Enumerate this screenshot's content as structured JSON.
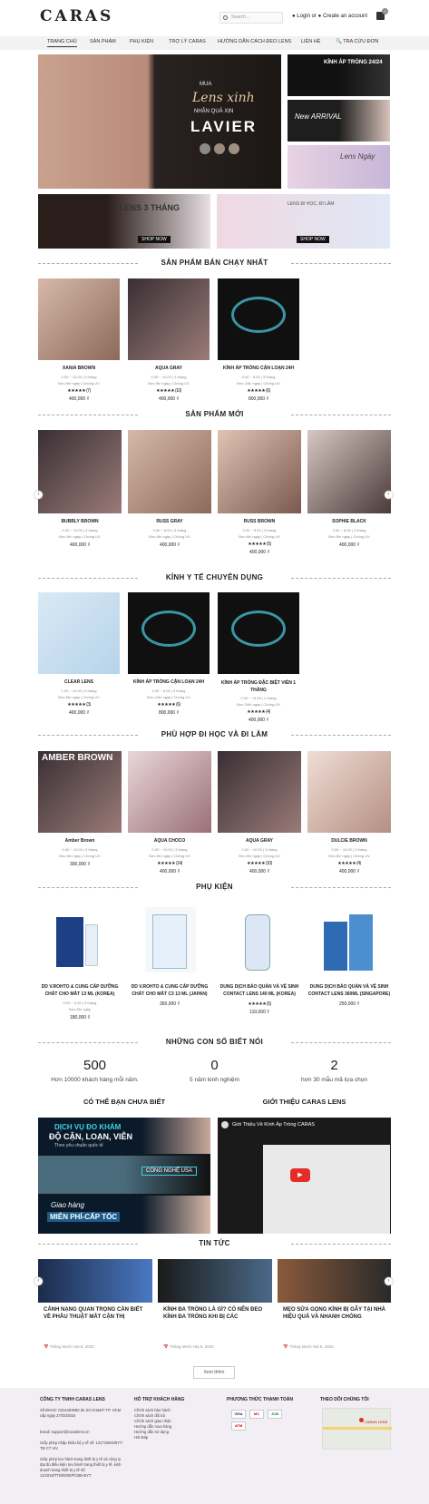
{
  "header": {
    "logo": "CARAS",
    "search_placeholder": "Search...",
    "login": "Login",
    "or": "or",
    "create": "Create an account",
    "cart_count": "0"
  },
  "nav": [
    "TRANG CHỦ",
    "SẢN PHẨM",
    "PHỤ KIỆN",
    "TRỢ LÝ CARAS",
    "HƯỚNG DẪN CÁCH ĐEO LENS",
    "LIÊN HỆ",
    "TRA CỨU ĐƠN"
  ],
  "banners": {
    "main_line1": "MUA",
    "main_line2": "Lens xinh",
    "main_line3": "NHẬN QUÀ XỊN",
    "main_brand": "LAVIER",
    "side1": "KÍNH ÁP TRÒNG 24/24",
    "side2": "New ARRIVAL",
    "side3": "Lens Ngày",
    "b2a": "LENS 3 THÁNG",
    "b2a_btn": "SHOP NOW",
    "b2b": "LENS ĐI HỌC, ĐI LÀM",
    "b2b_btn": "SHOP NOW"
  },
  "bestsellers": {
    "title": "SẢN PHẨM BÁN CHẠY NHẤT",
    "items": [
      {
        "name": "XANIA BROWN",
        "sub1": "0.00 ~ 10.00 | 3 tháng",
        "sub2": "Đeo 8h/ ngày | Chống UV",
        "stars": "★★★★★",
        "count": "(7)",
        "price": "400,000 ₫"
      },
      {
        "name": "AQUA GRAY",
        "sub1": "0.00 ~ 10.00 | 3 tháng",
        "sub2": "Đeo 8h/ ngày | Chống UV",
        "stars": "★★★★★",
        "count": "(10)",
        "price": "400,000 ₫"
      },
      {
        "name": "KÍNH ÁP TRÒNG CẬN LOẠN 24H",
        "sub1": "0.00 ~ 6.00 | 3 tháng",
        "sub2": "Đeo 24h/ ngày | Chống UV",
        "stars": "★★★★★",
        "count": "(6)",
        "price": "800,000 ₫"
      }
    ]
  },
  "newproducts": {
    "title": "SẢN PHẨM MỚI",
    "items": [
      {
        "name": "BUBBLY BROWN",
        "sub1": "0.00 ~ 10.00 | 3 tháng",
        "sub2": "Đeo 8h/ ngày | Chống UV",
        "price": "400,000 ₫"
      },
      {
        "name": "RUSS GRAY",
        "sub1": "0.00 ~ 8.00 | 3 tháng",
        "sub2": "Đeo 8h/ ngày | Chống UV",
        "price": "400,000 ₫"
      },
      {
        "name": "RUSS BROWN",
        "sub1": "0.00 ~ 8.00 | 3 tháng",
        "sub2": "Đeo 8h/ ngày | Chống UV",
        "stars": "★★★★★",
        "count": "(5)",
        "price": "400,000 ₫"
      },
      {
        "name": "SOPHIE BLACK",
        "sub1": "0.00 ~ 8.00 | 3 tháng",
        "sub2": "Đeo 8h/ ngày | Chống UV",
        "price": "400,000 ₫"
      }
    ]
  },
  "medical": {
    "title": "KÍNH Y TẾ CHUYÊN DỤNG",
    "items": [
      {
        "name": "CLEAR LENS",
        "sub1": "1.00 ~ 10.00 | 3 tháng",
        "sub2": "Đeo 8h/ ngày | Chống UV",
        "stars": "★★★★★",
        "count": "(3)",
        "price": "400,000 ₫"
      },
      {
        "name": "KÍNH ÁP TRÒNG CẬN LOẠN 24H",
        "sub1": "0.00 ~ 6.00 | 3 tháng",
        "sub2": "Đeo 24h/ ngày | Chống UV",
        "stars": "★★★★★",
        "count": "(6)",
        "price": "800,000 ₫"
      },
      {
        "name": "KÍNH ÁP TRÒNG ĐẶC BIỆT VIỄN 1 THÁNG",
        "sub1": "0.00 ~ +6.00 | 1 tháng",
        "sub2": "Đeo 24h/ ngày | Chống UV",
        "stars": "★★★★★",
        "count": "(4)",
        "price": "400,000 ₫"
      }
    ]
  },
  "school": {
    "title": "PHÙ HỢP ĐI HỌC VÀ ĐI LÀM",
    "items": [
      {
        "name": "Amber Brown",
        "sub1": "0.00 ~ 10.00 | 3 tháng",
        "sub2": "Đeo 8h/ ngày | Chống UV",
        "price": "300,000 ₫"
      },
      {
        "name": "AQUA CHOCO",
        "sub1": "0.00 ~ 10.00 | 3 tháng",
        "sub2": "Đeo 8h/ ngày | Chống UV",
        "stars": "★★★★★",
        "count": "(14)",
        "price": "400,000 ₫"
      },
      {
        "name": "AQUA GRAY",
        "sub1": "0.00 ~ 10.00 | 3 tháng",
        "sub2": "Đeo 8h/ ngày | Chống UV",
        "stars": "★★★★★",
        "count": "(10)",
        "price": "400,000 ₫"
      },
      {
        "name": "DULCIE BROWN",
        "sub1": "0.00 ~ 10.00 | 3 tháng",
        "sub2": "Đeo 8h/ ngày | Chống UV",
        "stars": "★★★★★",
        "count": "(4)",
        "price": "400,000 ₫"
      }
    ]
  },
  "accessories": {
    "title": "PHỤ KIỆN",
    "items": [
      {
        "name": "DD V.ROHTO & CUNG CẤP DƯỠNG CHẤT CHO MẮT 13 ML (KOREA)",
        "sub1": "0.00 ~ 0.00 | 3 tháng",
        "sub2": "Đeo 8h/ ngày",
        "price": "180,000 ₫"
      },
      {
        "name": "DD V.ROHTO & CUNG CẤP DƯỠNG CHẤT CHO MẮT C3 13 ML (JAPAN)",
        "price": "350,000 ₫"
      },
      {
        "name": "DUNG DỊCH BẢO QUẢN VÀ VỆ SINH CONTACT LENS 140 ML (KOREA)",
        "stars": "★★★★★",
        "count": "(5)",
        "price": "110,000 ₫"
      },
      {
        "name": "DUNG DỊCH BẢO QUẢN VÀ VỆ SINH CONTACT LENS 360ML (SINGAPORE)",
        "price": "250,000 ₫"
      }
    ]
  },
  "stats": {
    "title": "NHỮNG CON SỐ BIẾT NÓI",
    "items": [
      {
        "num": "500",
        "label": "Hơn 10000 khách hàng mỗi năm."
      },
      {
        "num": "0",
        "label": "5 năm kinh nghiệm"
      },
      {
        "num": "2",
        "label": "hơn 30 mẫu mã lựa chọn"
      }
    ]
  },
  "about": {
    "left_title": "CÓ THỂ BẠN CHƯA BIẾT",
    "right_title": "GIỚI THIỆU CARAS LENS",
    "promo1a": "DỊCH VỤ ĐO KHÁM",
    "promo1b": "ĐỘ CẬN, LOẠN, VIỄN",
    "promo1c": "Theo yêu chuẩn quốc tế",
    "promo2": "CÔNG NGHỆ USA",
    "promo3a": "Giao hàng",
    "promo3b": "MIỄN PHÍ-CẤP TỐC",
    "video_title": "Giới Thiệu Về Kính Áp Tròng CARAS"
  },
  "news": {
    "title": "TIN TỨC",
    "items": [
      {
        "title": "CẢNH NẠNG QUAN TRỌNG CẦN BIẾT VỀ PHẪU THUẬT MẮT CẬN THỊ",
        "date": "Tháng Mười Hai 8, 2020"
      },
      {
        "title": "KÍNH ĐA TRÒNG LÀ GÌ? CÓ NÊN ĐEO KÍNH ĐA TRÒNG KHI BỊ CÁC",
        "date": "Tháng Mười Hai 5, 2020"
      },
      {
        "title": "MẸO SỬA GỌNG KÍNH BỊ GÃY TẠI NHÀ HIỆU QUẢ VÀ NHANH CHÓNG",
        "date": "Tháng Mười Hai 5, 2020"
      }
    ],
    "more": "Xem thêm"
  },
  "footer": {
    "c1_title": "CÔNG TY TNHH CARAS LENS",
    "c1_lines": [
      "Số ĐKKD: 0314493690 do Sở KH&ĐT TP. HCM cấp ngày 27/03/2016",
      "Email: support@caraslens.vn",
      "Giấy phép nhập khẩu bộ y tế số: 131716NK/BYT-TB-CT ViV",
      "Giấy phép lưu hành trang thiết bị y tế và công ty đạt đủ điều kiện lưu hành trang thiết bị y tế, kinh doanh trang thiết bị y tế số: 11/2018/TTB/0000/PCBB-BYT"
    ],
    "c2_title": "HỖ TRỢ KHÁCH HÀNG",
    "c2_lines": [
      "Chính sách bảo hành",
      "Chính sách đổi trả",
      "Chính sách giao nhận",
      "Hướng dẫn mua hàng",
      "Hướng dẫn sử dụng",
      "Hỏi Đáp"
    ],
    "c3_title": "PHƯƠNG THỨC THANH TOÁN",
    "c3_cards": [
      "VISA",
      "MC",
      "JCB",
      "ATM"
    ],
    "c4_title": "THEO DÕI CHÚNG TÔI",
    "map_label": "CARAS LENS"
  }
}
